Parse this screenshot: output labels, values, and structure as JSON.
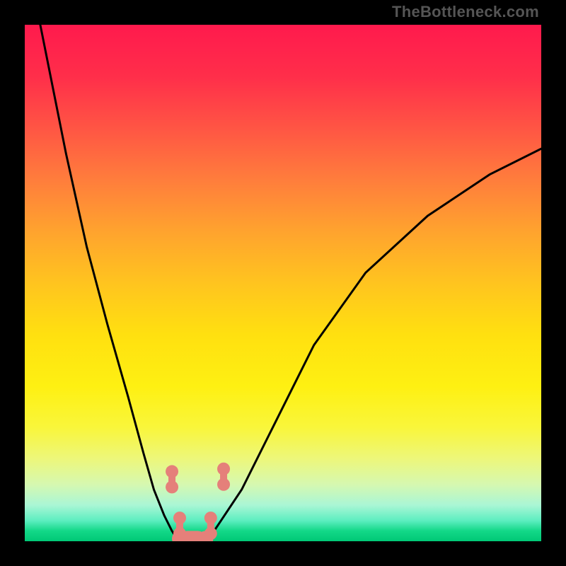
{
  "watermark": "TheBottleneck.com",
  "chart_data": {
    "type": "line",
    "title": "",
    "xlabel": "",
    "ylabel": "",
    "xlim": [
      0,
      100
    ],
    "ylim": [
      0,
      100
    ],
    "series": [
      {
        "name": "left-curve",
        "x": [
          3,
          8,
          12,
          16,
          20,
          23,
          25,
          27,
          28.5,
          29.5,
          30
        ],
        "y": [
          100,
          75,
          57,
          42,
          28,
          17,
          10,
          5,
          2,
          0.5,
          0
        ]
      },
      {
        "name": "right-curve",
        "x": [
          35,
          36,
          38,
          42,
          48,
          56,
          66,
          78,
          90,
          100
        ],
        "y": [
          0,
          1,
          4,
          10,
          22,
          38,
          52,
          63,
          71,
          76
        ]
      }
    ],
    "annotations": [
      {
        "name": "left-upper-bead-pair",
        "shape": "dumbbell",
        "color": "#e5807a",
        "cx": 28.5,
        "cy": 12
      },
      {
        "name": "left-lower-bead-pair",
        "shape": "dumbbell",
        "color": "#e5807a",
        "cx": 30,
        "cy": 3
      },
      {
        "name": "right-upper-bead-pair",
        "shape": "dumbbell",
        "color": "#e5807a",
        "cx": 38.5,
        "cy": 12.5
      },
      {
        "name": "right-lower-bead-pair",
        "shape": "dumbbell",
        "color": "#e5807a",
        "cx": 36,
        "cy": 3
      },
      {
        "name": "bottom-sausage",
        "shape": "capsule",
        "color": "#e5807a",
        "x1": 30,
        "x2": 35,
        "y": 0.5
      }
    ]
  }
}
